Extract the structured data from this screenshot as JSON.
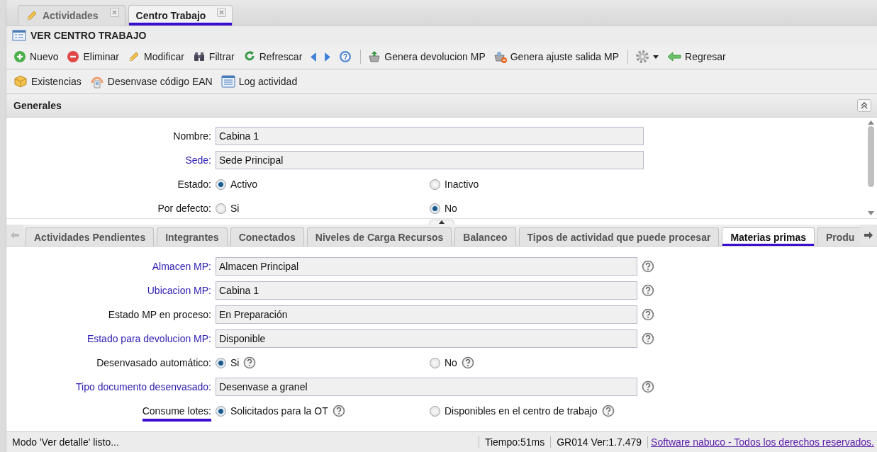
{
  "doc_tabs": [
    {
      "label": "Actividades",
      "selected": false,
      "annotated": false
    },
    {
      "label": "Centro Trabajo",
      "selected": true,
      "annotated": true
    }
  ],
  "view_title": "VER CENTRO TRABAJO",
  "toolbar_rows": [
    [
      {
        "kind": "button",
        "label": "Nuevo"
      },
      {
        "kind": "button",
        "label": "Eliminar"
      },
      {
        "kind": "button",
        "label": "Modificar"
      },
      {
        "kind": "button",
        "label": "Filtrar"
      },
      {
        "kind": "button",
        "label": "Refrescar"
      },
      {
        "kind": "icon"
      },
      {
        "kind": "icon"
      },
      {
        "kind": "icon"
      },
      {
        "kind": "separator"
      },
      {
        "kind": "button",
        "label": "Genera devolucion MP"
      },
      {
        "kind": "button",
        "label": "Genera ajuste salida MP"
      },
      {
        "kind": "separator"
      },
      {
        "kind": "menu"
      },
      {
        "kind": "button",
        "label": "Regresar"
      }
    ],
    [
      {
        "kind": "button",
        "label": "Existencias"
      },
      {
        "kind": "button",
        "label": "Desenvase código EAN"
      },
      {
        "kind": "button",
        "label": "Log actividad"
      }
    ]
  ],
  "section_title": "Generales",
  "upper_form": [
    {
      "kind": "text",
      "label": "Nombre:",
      "link": false,
      "value": "Cabina 1",
      "annotated": false
    },
    {
      "kind": "text",
      "label": "Sede:",
      "link": true,
      "value": "Sede Principal",
      "annotated": false
    },
    {
      "kind": "radio",
      "label": "Estado:",
      "link": false,
      "annotated": false,
      "options": [
        {
          "label": "Activo",
          "selected": true,
          "help": false
        },
        {
          "label": "Inactivo",
          "selected": false,
          "help": false
        }
      ]
    },
    {
      "kind": "radio",
      "label": "Por defecto:",
      "link": false,
      "annotated": false,
      "options": [
        {
          "label": "Si",
          "selected": false,
          "help": false
        },
        {
          "label": "No",
          "selected": true,
          "help": false
        }
      ]
    }
  ],
  "detail_tabs": [
    {
      "label": "Actividades Pendientes",
      "selected": false,
      "annotated": false
    },
    {
      "label": "Integrantes",
      "selected": false,
      "annotated": false
    },
    {
      "label": "Conectados",
      "selected": false,
      "annotated": false
    },
    {
      "label": "Niveles de Carga Recursos",
      "selected": false,
      "annotated": false
    },
    {
      "label": "Balanceo",
      "selected": false,
      "annotated": false
    },
    {
      "label": "Tipos de actividad que puede procesar",
      "selected": false,
      "annotated": false
    },
    {
      "label": "Materias primas",
      "selected": true,
      "annotated": true
    },
    {
      "label": "Produ",
      "selected": false,
      "annotated": false
    }
  ],
  "lower_form": [
    {
      "kind": "text",
      "label": "Almacen MP:",
      "link": true,
      "value": "Almacen Principal",
      "annotated": false
    },
    {
      "kind": "text",
      "label": "Ubicacion MP:",
      "link": true,
      "value": "Cabina 1",
      "annotated": false
    },
    {
      "kind": "text",
      "label": "Estado MP en proceso:",
      "link": false,
      "value": "En Preparación",
      "annotated": false
    },
    {
      "kind": "text",
      "label": "Estado para devolucion MP:",
      "link": true,
      "value": "Disponible",
      "annotated": false
    },
    {
      "kind": "radio",
      "label": "Desenvasado automático:",
      "link": false,
      "annotated": false,
      "options": [
        {
          "label": "Si",
          "selected": true,
          "help": true
        },
        {
          "label": "No",
          "selected": false,
          "help": true
        }
      ]
    },
    {
      "kind": "text",
      "label": "Tipo documento desenvasado:",
      "link": true,
      "value": "Desenvase a granel",
      "annotated": false
    },
    {
      "kind": "radio",
      "label": "Consume lotes:",
      "link": false,
      "annotated": true,
      "options": [
        {
          "label": "Solicitados para la OT",
          "selected": true,
          "help": true
        },
        {
          "label": "Disponibles en el centro de trabajo",
          "selected": false,
          "help": true
        }
      ]
    }
  ],
  "status_bar": {
    "message": "Modo 'Ver detalle' listo...",
    "time": "Tiempo:51ms",
    "version": "GR014 Ver:1.7.479",
    "link": "Software nabuco - Todos los derechos reservados."
  }
}
